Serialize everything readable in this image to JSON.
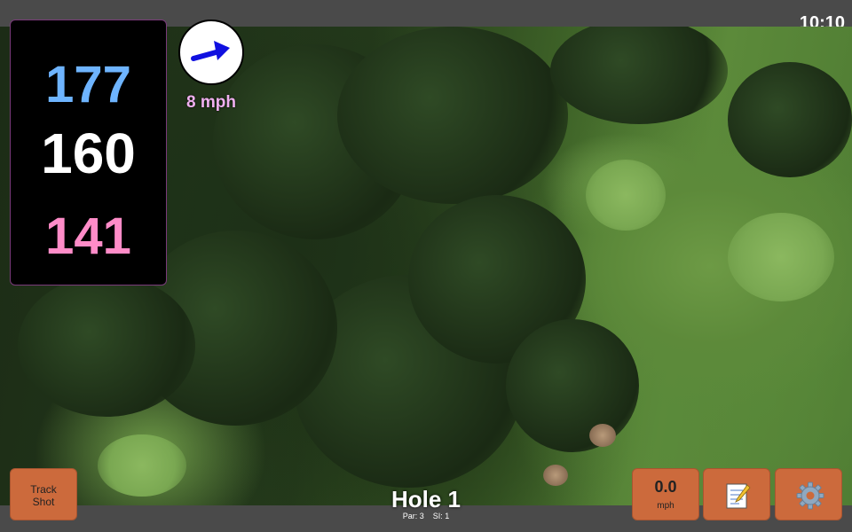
{
  "status_bar": {
    "time": "10:10"
  },
  "distances": {
    "back": "177",
    "middle": "160",
    "front": "141"
  },
  "wind": {
    "speed": "8 mph",
    "icon": "wind-direction-arrow-icon"
  },
  "buttons": {
    "track_shot": "Track\nShot",
    "speed_value": "0.0",
    "speed_unit": "mph",
    "notes_icon": "notepad-icon",
    "settings_icon": "gear-icon"
  },
  "hole": {
    "title": "Hole 1",
    "par": "Par: 3",
    "si": "SI: 1"
  },
  "colors": {
    "back_distance": "#6eb4ff",
    "middle_distance": "#ffffff",
    "front_distance": "#ff8cc8",
    "button": "#cc6a3c",
    "wind_arrow": "#1010e0"
  }
}
